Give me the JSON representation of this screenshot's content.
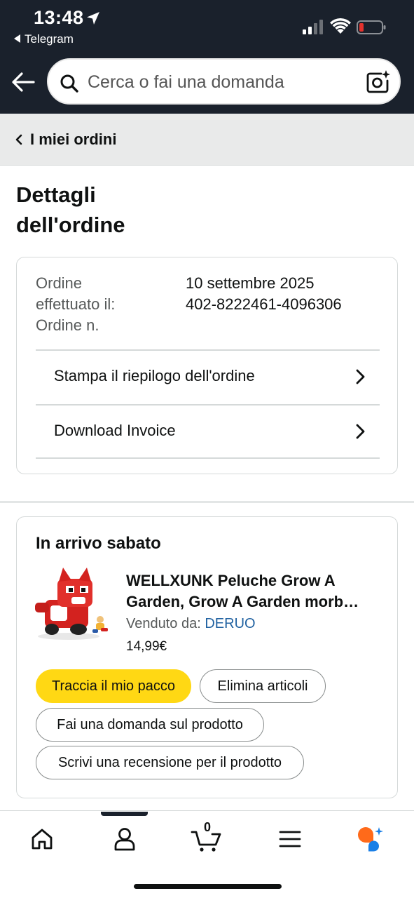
{
  "status_bar": {
    "time": "13:48",
    "back_app": "Telegram"
  },
  "search": {
    "placeholder": "Cerca o fai una domanda"
  },
  "breadcrumb": {
    "label": "I miei ordini"
  },
  "page": {
    "title_line1": "Dettagli",
    "title_line2": "dell'ordine"
  },
  "order": {
    "placed_label_line1": "Ordine",
    "placed_label_line2": "effettuato il:",
    "number_label": "Ordine n.",
    "placed_date": "10 settembre 2025",
    "number": "402-8222461-4096306",
    "links": [
      {
        "label": "Stampa il riepilogo dell'ordine"
      },
      {
        "label": "Download Invoice"
      }
    ]
  },
  "shipment": {
    "title": "In arrivo sabato",
    "product_title_line1": "WELLXUNK Peluche Grow A",
    "product_title_line2": "Garden, Grow A Garden morb…",
    "seller_label": "Venduto da:",
    "seller_name": "DERUO",
    "price": "14,99€",
    "buttons": {
      "track": "Traccia il mio pacco",
      "delete": "Elimina articoli",
      "question": "Fai una domanda sul prodotto",
      "review": "Scrivi una recensione per il prodotto"
    }
  },
  "tabbar": {
    "cart_count": "0",
    "icons": [
      "home-icon",
      "account-icon",
      "cart-icon",
      "menu-icon",
      "rufus-icon"
    ]
  },
  "colors": {
    "header_bg": "#1a212c",
    "breadcrumb_bg": "#e9eaea",
    "primary_button": "#ffd814",
    "link_blue": "#2162a1",
    "battery_low": "#e5322d",
    "rufus_orange": "#ff6a1a",
    "rufus_blue": "#1a7fe6"
  }
}
